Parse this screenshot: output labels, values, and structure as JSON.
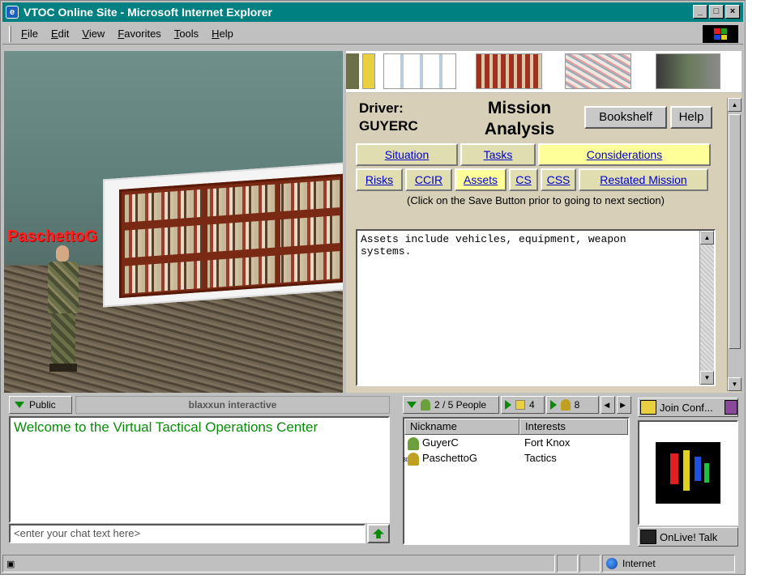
{
  "window": {
    "title": "VTOC Online Site - Microsoft Internet Explorer"
  },
  "menu": [
    {
      "key": "F",
      "rest": "ile"
    },
    {
      "key": "E",
      "rest": "dit"
    },
    {
      "key": "V",
      "rest": "iew"
    },
    {
      "key": "F",
      "rest": "avorites"
    },
    {
      "key": "T",
      "rest": "ools"
    },
    {
      "key": "H",
      "rest": "elp"
    }
  ],
  "scene": {
    "avatar_name": "PaschettoG"
  },
  "panel": {
    "driver_label": "Driver:",
    "driver_name": "GUYERC",
    "title_line1": "Mission",
    "title_line2": "Analysis",
    "bookshelf_btn": "Bookshelf",
    "help_btn": "Help",
    "tabs_row1": [
      "Situation",
      "Tasks",
      "Considerations"
    ],
    "tabs_row2": [
      "Risks",
      "CCIR",
      "Assets",
      "CS",
      "CSS",
      "Restated Mission"
    ],
    "note": "(Click on the Save Button prior to going to next section)",
    "text": "Assets include vehicles, equipment, weapon\nsystems."
  },
  "chat": {
    "tab_label": "Public",
    "brand": "blaxxun interactive",
    "welcome": "Welcome to the Virtual Tactical Operations Center",
    "input_placeholder": "<enter your chat text here>"
  },
  "people": {
    "count": "2 / 5 People",
    "rooms": "4",
    "others": "8",
    "col_nickname": "Nickname",
    "col_interests": "Interests",
    "rows": [
      {
        "nick": "GuyerC",
        "interest": "Fort Knox",
        "badge": ""
      },
      {
        "nick": "PaschettoG",
        "interest": "Tactics",
        "badge": "3D"
      }
    ]
  },
  "comm": {
    "join_conf": "Join Conf...",
    "onlive": "OnLive! Talk"
  },
  "status": {
    "zone": "Internet"
  }
}
